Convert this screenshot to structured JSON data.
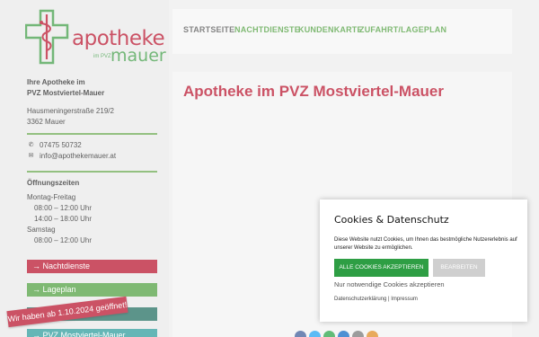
{
  "logo": {
    "word1": "apotheke",
    "word2": "mauer",
    "small": "im PVZ"
  },
  "nav": {
    "items": [
      "STARTSEITE",
      "NACHTDIENSTE",
      "KUNDENKARTE",
      "ZUFAHRT/LAGEPLAN"
    ]
  },
  "sidebar": {
    "name_line1": "Ihre Apotheke im",
    "name_line2": "PVZ Mostviertel-Mauer",
    "street": "Hausmeningerstraße 219/2",
    "city": "3362 Mauer",
    "phone": "07475 50732",
    "email": "info@apothekemauer.at",
    "hours_title": "Öffnungszeiten",
    "weekday_label": "Montag-Freitag",
    "weekday_1": "08:00 – 12:00 Uhr",
    "weekday_2": "14:00 – 18:00 Uhr",
    "saturday_label": "Samstag",
    "saturday_1": "08:00 – 12:00 Uhr",
    "btn_nachtdienste": "→  Nachtdienste",
    "btn_lageplan": "→  Lageplan",
    "btn_pvz": "→  PVZ Mostviertel-Mauer"
  },
  "badge": "Wir haben ab 1.10.2024 geöffnet!",
  "main": {
    "title": "Apotheke im PVZ Mostviertel-Mauer"
  },
  "cookie": {
    "title": "Cookies & Datenschutz",
    "text": "Diese Website nutzt Cookies, um Ihnen das bestmögliche Nutzererlebnis auf unserer Website zu ermöglichen.",
    "accept": "ALLE COOKIES AKZEPTIEREN",
    "edit": "BEARBEITEN",
    "necessary": "Nur notwendige Cookies akzeptieren",
    "links": "Datenschutzerklärung | Impressum"
  },
  "colors": {
    "brand_red": "#b8102a",
    "brand_green": "#4e9f3d",
    "accept_green": "#2e9e44"
  }
}
